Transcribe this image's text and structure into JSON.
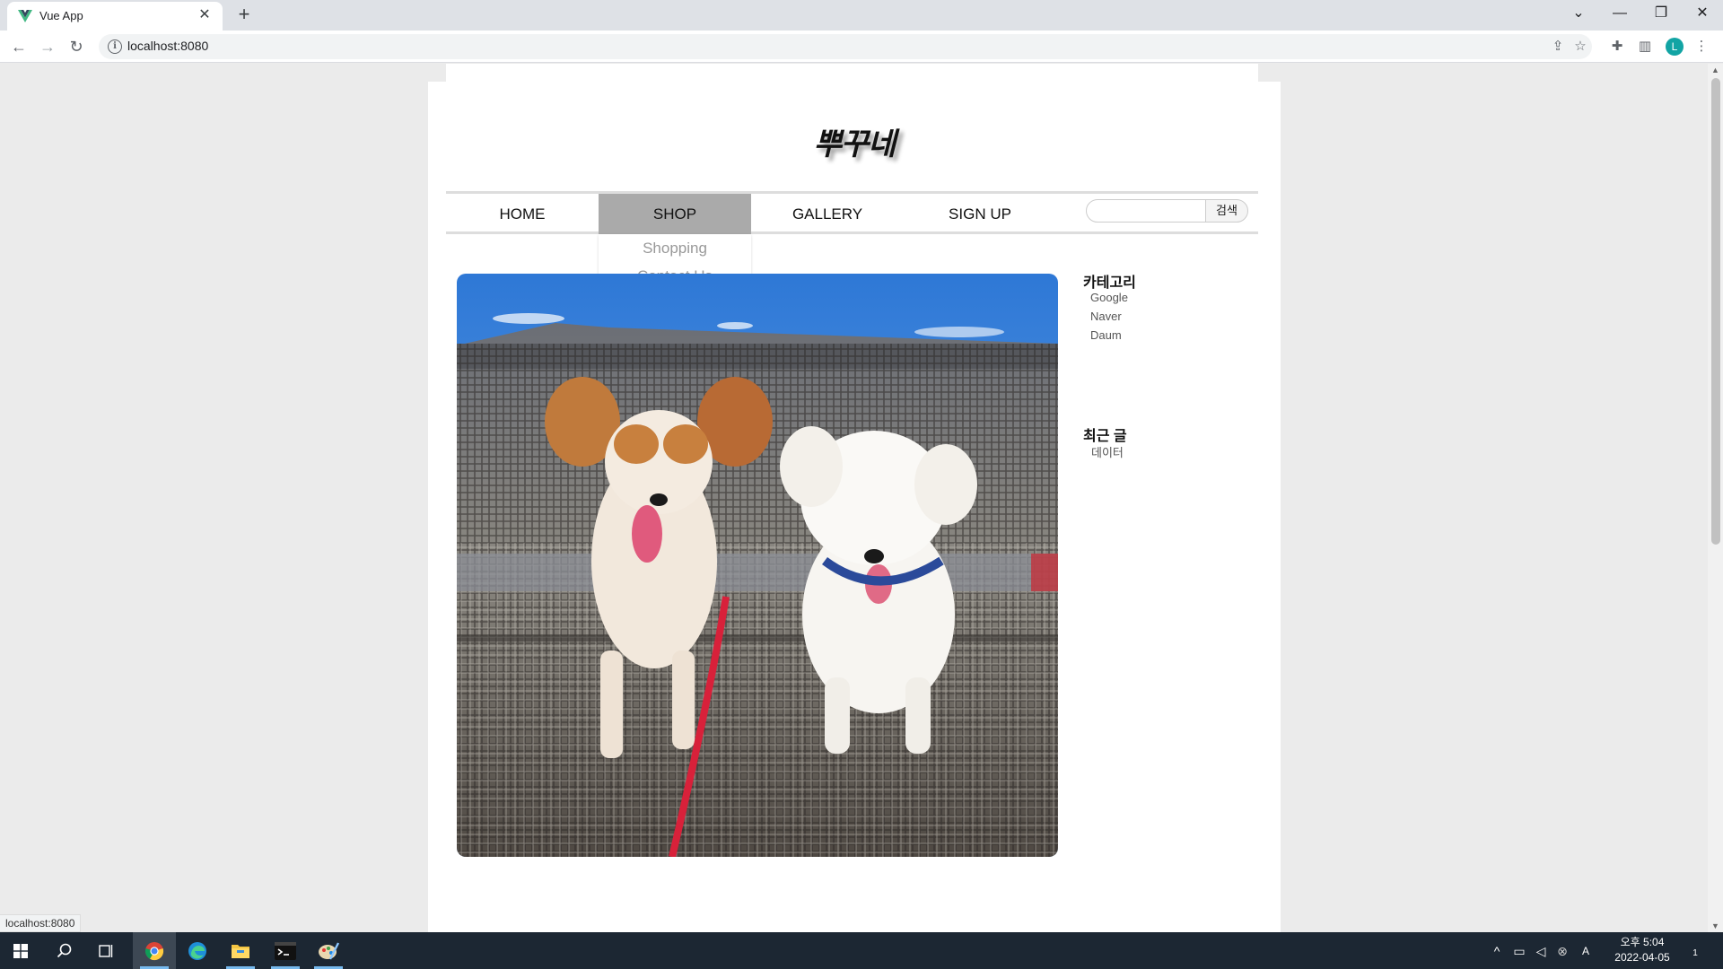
{
  "browser": {
    "tab_title": "Vue App",
    "new_tab_label": "+",
    "url": "localhost:8080",
    "status_url": "localhost:8080",
    "profile_initial": "L"
  },
  "site": {
    "logo": "뿌꾸네",
    "nav": {
      "items": [
        "HOME",
        "SHOP",
        "GALLERY",
        "SIGN UP"
      ],
      "active": "SHOP",
      "search_placeholder": "",
      "search_button": "검색"
    },
    "dropdown": [
      "Shopping",
      "Contact Us"
    ],
    "sidebar": {
      "category_title": "카테고리",
      "categories": [
        "Google",
        "Naver",
        "Daum"
      ],
      "recent_title": "최근 글",
      "recent_posts": [
        "데이터"
      ]
    }
  },
  "taskbar": {
    "clock_period": "오후 5:04",
    "date": "2022-04-05",
    "notification_count": "1",
    "lang_indicator": "A"
  },
  "colors": {
    "nav_active": "#aaaaaa",
    "taskbar": "#1c2733",
    "vue_green": "#41b883",
    "profile": "#12a4a4"
  }
}
